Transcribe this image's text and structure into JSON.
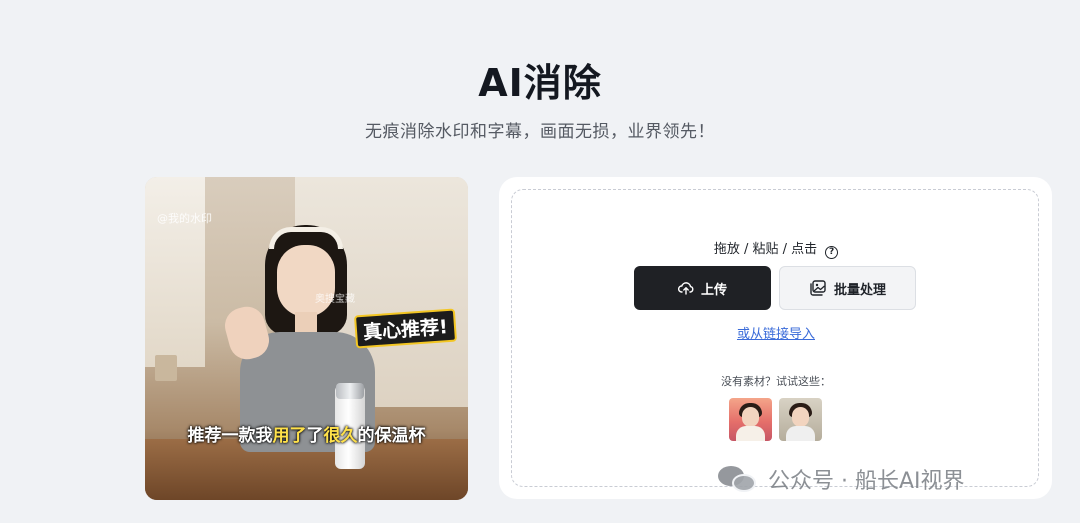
{
  "header": {
    "title": "AI消除",
    "subtitle": "无痕消除水印和字幕，画面无损，业界领先！"
  },
  "preview": {
    "watermark": "@我的水印",
    "watermark2": "奥搜宝藏",
    "sticker": "真心推荐!",
    "caption_pre": "推荐一款我",
    "caption_hl1": "用了",
    "caption_hl2": "很久",
    "caption_post": "的保温杯"
  },
  "upload": {
    "hint": "拖放 / 粘贴 / 点击",
    "upload_label": "上传",
    "batch_label": "批量处理",
    "link_label": "或从链接导入",
    "samples_label": "没有素材？试试这些：",
    "icons": {
      "upload": "cloud-upload-icon",
      "batch": "image-stack-icon",
      "help": "help-circle-icon"
    },
    "colors": {
      "primary_button": "#1f2125",
      "link": "#3a6bd9"
    }
  },
  "overlay": {
    "wechat_text": "公众号 · 船长AI视界"
  }
}
